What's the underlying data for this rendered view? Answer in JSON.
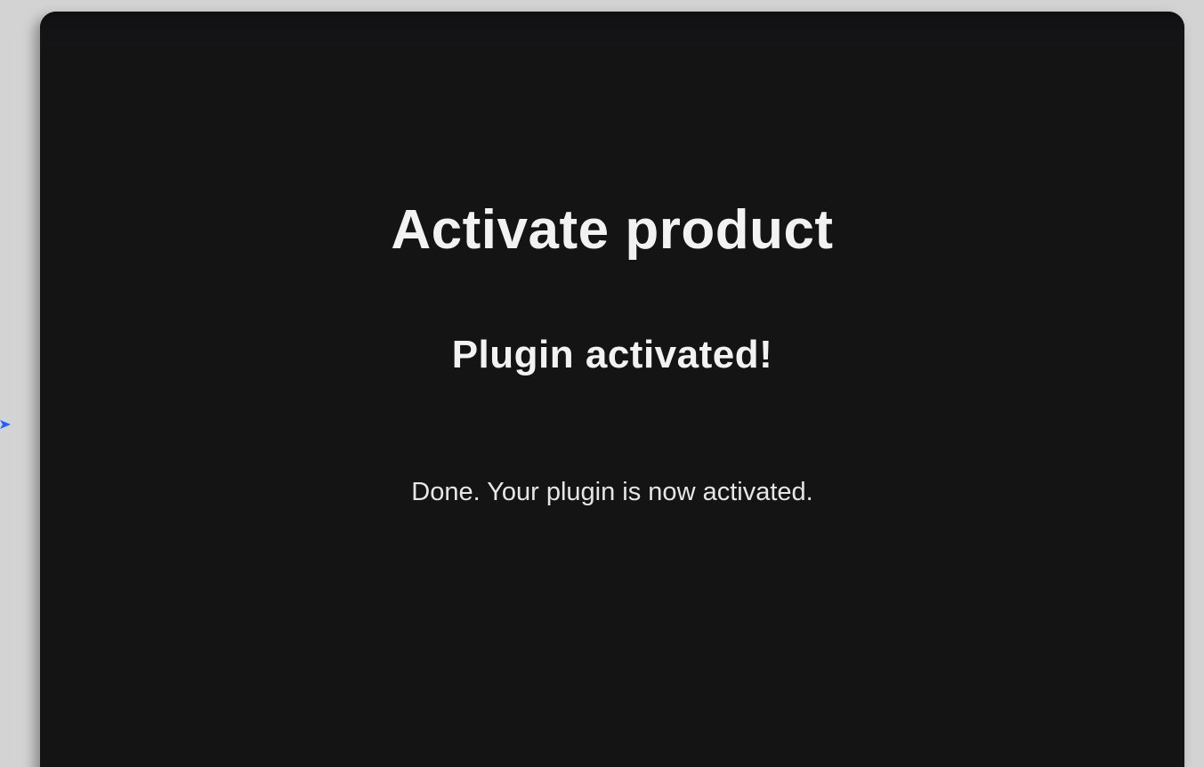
{
  "dialog": {
    "title": "Activate product",
    "subtitle": "Plugin activated!",
    "message": "Done. Your plugin is now activated."
  },
  "icons": {
    "pointer": "arrow-pointer-icon"
  },
  "colors": {
    "backdrop": "#d3d3d3",
    "dialog_background": "#141414",
    "text": "#f2f2f2",
    "pointer": "#1f5fff"
  }
}
